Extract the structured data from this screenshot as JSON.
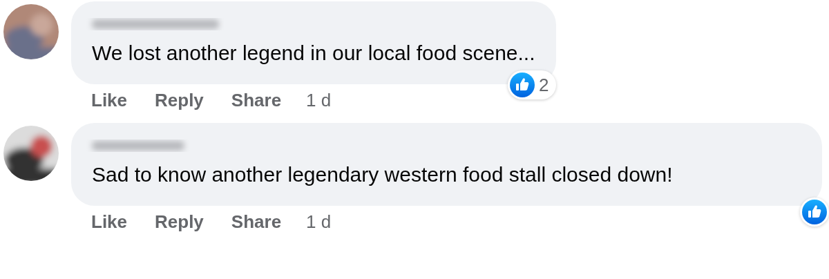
{
  "comments": [
    {
      "text": "We lost another legend in our local food scene...",
      "reaction": {
        "kind": "like",
        "count": "2"
      },
      "actions": [
        "Like",
        "Reply",
        "Share"
      ],
      "time": "1 d"
    },
    {
      "text": "Sad to know another legendary western food stall closed down!",
      "reaction": {
        "kind": "like"
      },
      "actions": [
        "Like",
        "Reply",
        "Share"
      ],
      "time": "1 d"
    }
  ]
}
